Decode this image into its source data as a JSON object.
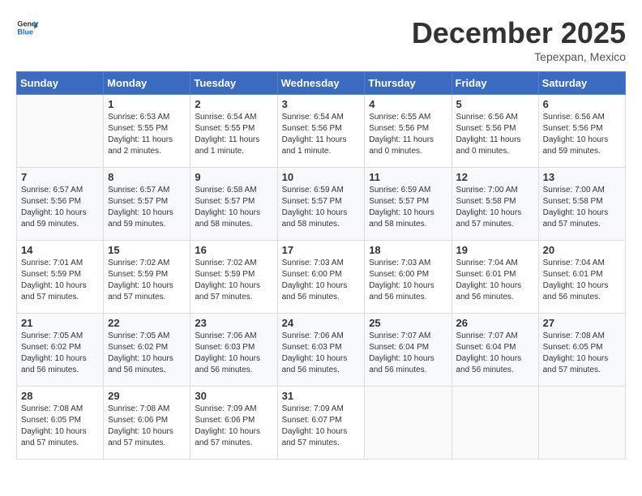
{
  "header": {
    "logo_general": "General",
    "logo_blue": "Blue",
    "month_title": "December 2025",
    "location": "Tepexpan, Mexico"
  },
  "days_of_week": [
    "Sunday",
    "Monday",
    "Tuesday",
    "Wednesday",
    "Thursday",
    "Friday",
    "Saturday"
  ],
  "weeks": [
    [
      {
        "day": "",
        "info": ""
      },
      {
        "day": "1",
        "info": "Sunrise: 6:53 AM\nSunset: 5:55 PM\nDaylight: 11 hours\nand 2 minutes."
      },
      {
        "day": "2",
        "info": "Sunrise: 6:54 AM\nSunset: 5:55 PM\nDaylight: 11 hours\nand 1 minute."
      },
      {
        "day": "3",
        "info": "Sunrise: 6:54 AM\nSunset: 5:56 PM\nDaylight: 11 hours\nand 1 minute."
      },
      {
        "day": "4",
        "info": "Sunrise: 6:55 AM\nSunset: 5:56 PM\nDaylight: 11 hours\nand 0 minutes."
      },
      {
        "day": "5",
        "info": "Sunrise: 6:56 AM\nSunset: 5:56 PM\nDaylight: 11 hours\nand 0 minutes."
      },
      {
        "day": "6",
        "info": "Sunrise: 6:56 AM\nSunset: 5:56 PM\nDaylight: 10 hours\nand 59 minutes."
      }
    ],
    [
      {
        "day": "7",
        "info": "Sunrise: 6:57 AM\nSunset: 5:56 PM\nDaylight: 10 hours\nand 59 minutes."
      },
      {
        "day": "8",
        "info": "Sunrise: 6:57 AM\nSunset: 5:57 PM\nDaylight: 10 hours\nand 59 minutes."
      },
      {
        "day": "9",
        "info": "Sunrise: 6:58 AM\nSunset: 5:57 PM\nDaylight: 10 hours\nand 58 minutes."
      },
      {
        "day": "10",
        "info": "Sunrise: 6:59 AM\nSunset: 5:57 PM\nDaylight: 10 hours\nand 58 minutes."
      },
      {
        "day": "11",
        "info": "Sunrise: 6:59 AM\nSunset: 5:57 PM\nDaylight: 10 hours\nand 58 minutes."
      },
      {
        "day": "12",
        "info": "Sunrise: 7:00 AM\nSunset: 5:58 PM\nDaylight: 10 hours\nand 57 minutes."
      },
      {
        "day": "13",
        "info": "Sunrise: 7:00 AM\nSunset: 5:58 PM\nDaylight: 10 hours\nand 57 minutes."
      }
    ],
    [
      {
        "day": "14",
        "info": "Sunrise: 7:01 AM\nSunset: 5:59 PM\nDaylight: 10 hours\nand 57 minutes."
      },
      {
        "day": "15",
        "info": "Sunrise: 7:02 AM\nSunset: 5:59 PM\nDaylight: 10 hours\nand 57 minutes."
      },
      {
        "day": "16",
        "info": "Sunrise: 7:02 AM\nSunset: 5:59 PM\nDaylight: 10 hours\nand 57 minutes."
      },
      {
        "day": "17",
        "info": "Sunrise: 7:03 AM\nSunset: 6:00 PM\nDaylight: 10 hours\nand 56 minutes."
      },
      {
        "day": "18",
        "info": "Sunrise: 7:03 AM\nSunset: 6:00 PM\nDaylight: 10 hours\nand 56 minutes."
      },
      {
        "day": "19",
        "info": "Sunrise: 7:04 AM\nSunset: 6:01 PM\nDaylight: 10 hours\nand 56 minutes."
      },
      {
        "day": "20",
        "info": "Sunrise: 7:04 AM\nSunset: 6:01 PM\nDaylight: 10 hours\nand 56 minutes."
      }
    ],
    [
      {
        "day": "21",
        "info": "Sunrise: 7:05 AM\nSunset: 6:02 PM\nDaylight: 10 hours\nand 56 minutes."
      },
      {
        "day": "22",
        "info": "Sunrise: 7:05 AM\nSunset: 6:02 PM\nDaylight: 10 hours\nand 56 minutes."
      },
      {
        "day": "23",
        "info": "Sunrise: 7:06 AM\nSunset: 6:03 PM\nDaylight: 10 hours\nand 56 minutes."
      },
      {
        "day": "24",
        "info": "Sunrise: 7:06 AM\nSunset: 6:03 PM\nDaylight: 10 hours\nand 56 minutes."
      },
      {
        "day": "25",
        "info": "Sunrise: 7:07 AM\nSunset: 6:04 PM\nDaylight: 10 hours\nand 56 minutes."
      },
      {
        "day": "26",
        "info": "Sunrise: 7:07 AM\nSunset: 6:04 PM\nDaylight: 10 hours\nand 56 minutes."
      },
      {
        "day": "27",
        "info": "Sunrise: 7:08 AM\nSunset: 6:05 PM\nDaylight: 10 hours\nand 57 minutes."
      }
    ],
    [
      {
        "day": "28",
        "info": "Sunrise: 7:08 AM\nSunset: 6:05 PM\nDaylight: 10 hours\nand 57 minutes."
      },
      {
        "day": "29",
        "info": "Sunrise: 7:08 AM\nSunset: 6:06 PM\nDaylight: 10 hours\nand 57 minutes."
      },
      {
        "day": "30",
        "info": "Sunrise: 7:09 AM\nSunset: 6:06 PM\nDaylight: 10 hours\nand 57 minutes."
      },
      {
        "day": "31",
        "info": "Sunrise: 7:09 AM\nSunset: 6:07 PM\nDaylight: 10 hours\nand 57 minutes."
      },
      {
        "day": "",
        "info": ""
      },
      {
        "day": "",
        "info": ""
      },
      {
        "day": "",
        "info": ""
      }
    ]
  ]
}
